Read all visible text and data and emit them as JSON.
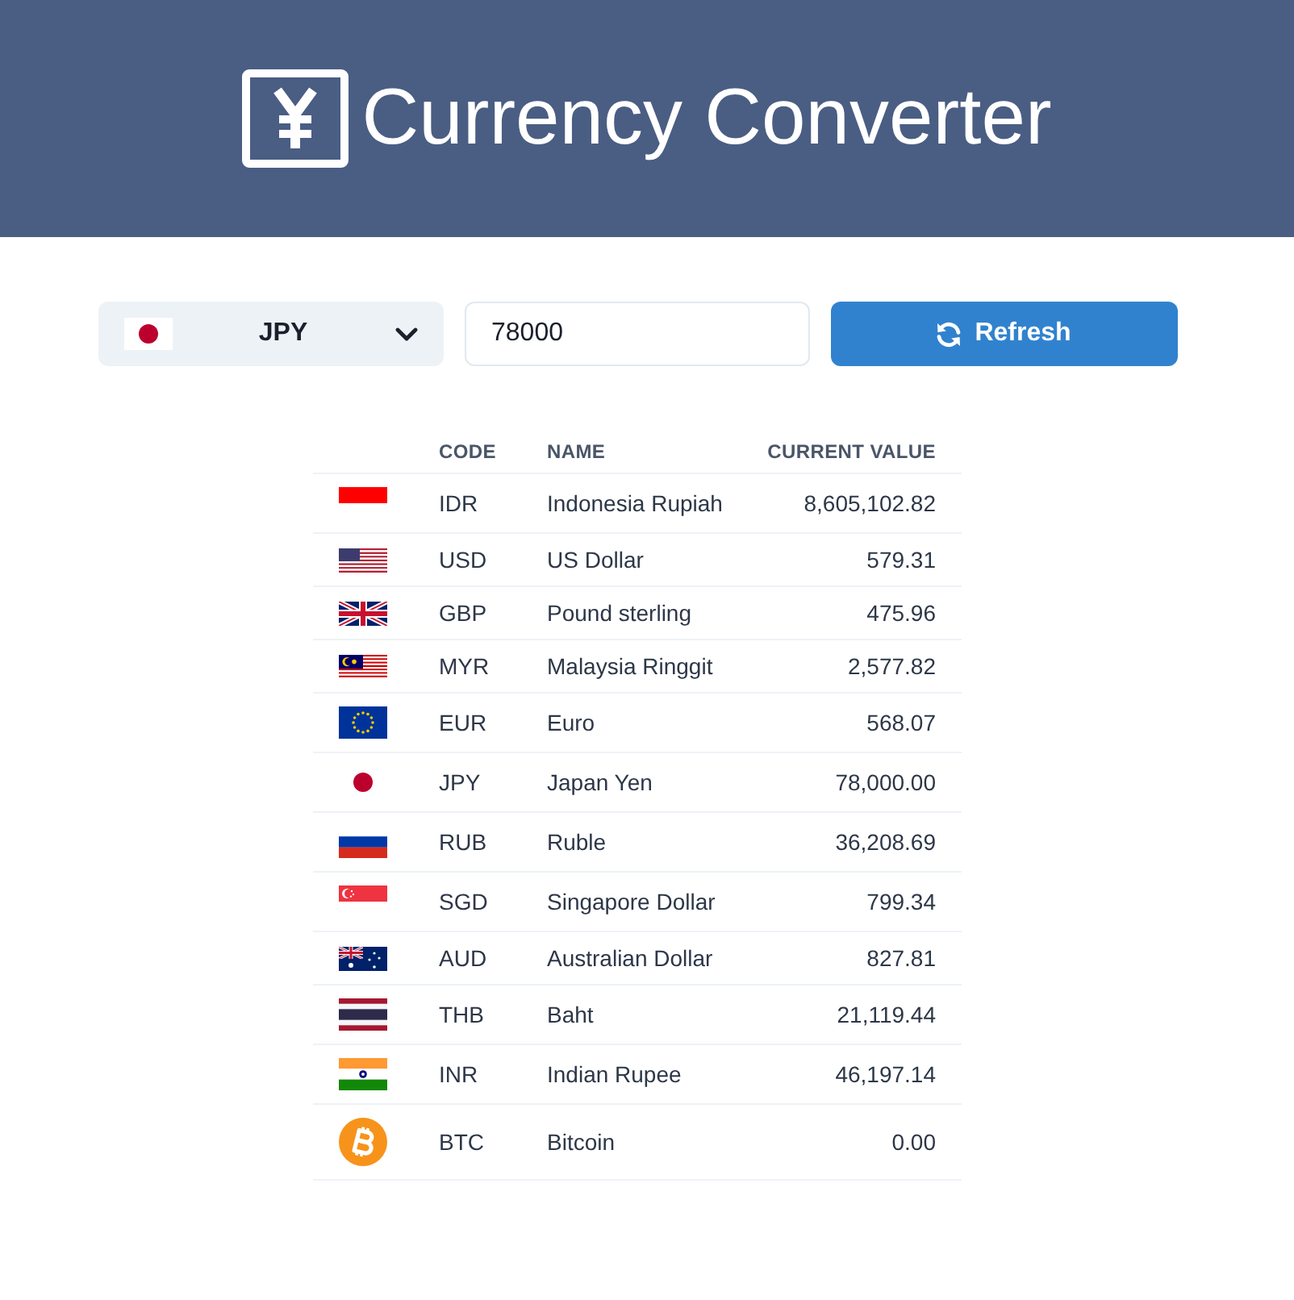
{
  "header": {
    "title": "Currency Converter"
  },
  "converter": {
    "currency_dropdown": {
      "value": "JPY"
    },
    "amount_field": {
      "value": "78000"
    },
    "refresh_button": {
      "label": "Refresh"
    }
  },
  "rates_table": {
    "columns": [
      "CODE",
      "NAME",
      "CURRENT VALUE"
    ],
    "rows": [
      {
        "code": "IDR",
        "name": "Indonesia Rupiah",
        "value": "8,605,102.82"
      },
      {
        "code": "USD",
        "name": "US Dollar",
        "value": "579.31"
      },
      {
        "code": "GBP",
        "name": "Pound sterling",
        "value": "475.96"
      },
      {
        "code": "MYR",
        "name": "Malaysia Ringgit",
        "value": "2,577.82"
      },
      {
        "code": "EUR",
        "name": "Euro",
        "value": "568.07"
      },
      {
        "code": "JPY",
        "name": "Japan Yen",
        "value": "78,000.00"
      },
      {
        "code": "RUB",
        "name": "Ruble",
        "value": "36,208.69"
      },
      {
        "code": "SGD",
        "name": "Singapore Dollar",
        "value": "799.34"
      },
      {
        "code": "AUD",
        "name": "Australian Dollar",
        "value": "827.81"
      },
      {
        "code": "THB",
        "name": "Baht",
        "value": "21,119.44"
      },
      {
        "code": "INR",
        "name": "Indian Rupee",
        "value": "46,197.14"
      },
      {
        "code": "BTC",
        "name": "Bitcoin",
        "value": "0.00"
      }
    ]
  }
}
